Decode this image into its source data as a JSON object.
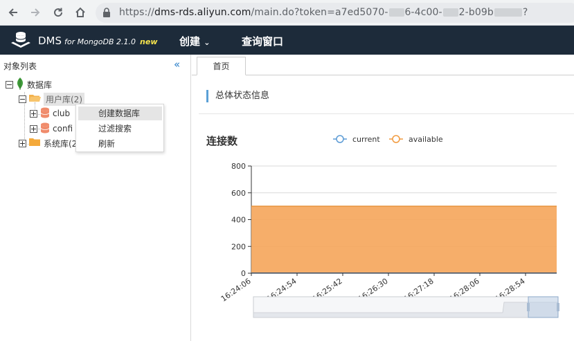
{
  "browser": {
    "url_scheme": "https://",
    "url_host": "dms-rds.aliyun.com",
    "url_path": "/main.do?token=a7ed5070-",
    "url_tail_1": "6-4c00-",
    "url_tail_2": "2-b09b",
    "url_tail_3": "?"
  },
  "header": {
    "brand": "DMS",
    "brand_sub": "for MongoDB 2.1.0",
    "brand_new": "new",
    "menu_create": "创建",
    "menu_query": "查询窗口"
  },
  "sidebar": {
    "title": "对象列表",
    "collapse_glyph": "«",
    "tree": {
      "root": "数据库",
      "user_db": "用户库(2)",
      "club": "club",
      "config": "confi",
      "system_db": "系统库(2"
    }
  },
  "context_menu": {
    "items": [
      "创建数据库",
      "过滤搜索",
      "刷新"
    ]
  },
  "main": {
    "tab_home": "首页",
    "section_title": "总体状态信息"
  },
  "chart_data": {
    "type": "area",
    "title": "连接数",
    "series": [
      {
        "name": "current",
        "color": "#5b9bd5",
        "values": [
          1,
          1,
          1,
          1,
          1,
          1,
          1,
          1
        ]
      },
      {
        "name": "available",
        "color": "#f5a55a",
        "values": [
          500,
          500,
          500,
          500,
          500,
          500,
          500,
          500
        ]
      }
    ],
    "x_tick_labels": [
      "16:24:06",
      "16:24:54",
      "16:25:42",
      "16:26:30",
      "16:27:18",
      "16:28:06",
      "16:28:54"
    ],
    "y_ticks": [
      0,
      200,
      400,
      600,
      800
    ],
    "ylim": [
      0,
      800
    ],
    "grid": true,
    "legend_position": "top"
  }
}
